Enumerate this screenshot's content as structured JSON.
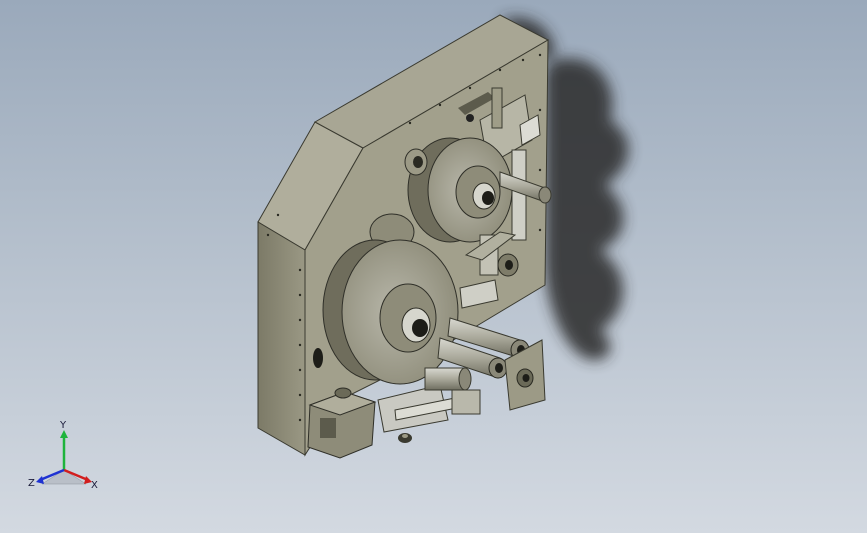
{
  "viewport": {
    "background_top": "#9aa9bb",
    "background_bottom": "#d3d9e1"
  },
  "model": {
    "body_color": "#8f8d78",
    "face_color": "#a5a392",
    "metal_color": "#c9c9c2",
    "shadow_color": "#2c2c2c"
  },
  "triad": {
    "x_label": "X",
    "y_label": "Y",
    "z_label": "Z",
    "x_color": "#d21e1e",
    "y_color": "#1eb43c",
    "z_color": "#1e32d2"
  }
}
